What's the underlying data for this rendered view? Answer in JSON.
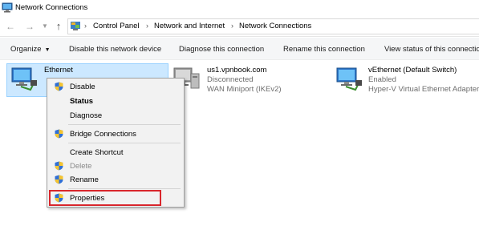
{
  "window": {
    "title": "Network Connections"
  },
  "address": {
    "crumbs": [
      "Control Panel",
      "Network and Internet",
      "Network Connections"
    ]
  },
  "toolbar": {
    "organize": "Organize",
    "disable": "Disable this network device",
    "diagnose": "Diagnose this connection",
    "rename": "Rename this connection",
    "view_status": "View status of this connection"
  },
  "items": [
    {
      "name": "Ethernet",
      "status": "",
      "adapter": "",
      "icon": "ethernet-adapter-icon",
      "selected": true
    },
    {
      "name": "us1.vpnbook.com",
      "status": "Disconnected",
      "adapter": "WAN Miniport (IKEv2)",
      "icon": "vpn-adapter-icon"
    },
    {
      "name": "vEthernet (Default Switch)",
      "status": "Enabled",
      "adapter": "Hyper-V Virtual Ethernet Adapter",
      "icon": "ethernet-adapter-icon"
    }
  ],
  "context_menu": {
    "items": [
      {
        "label": "Disable",
        "shield": true
      },
      {
        "label": "Status",
        "bold": true
      },
      {
        "label": "Diagnose"
      },
      {
        "label": "Bridge Connections",
        "shield": true
      },
      {
        "label": "Create Shortcut"
      },
      {
        "label": "Delete",
        "shield": true,
        "disabled": true
      },
      {
        "label": "Rename",
        "shield": true
      },
      {
        "label": "Properties",
        "shield": true,
        "highlighted": true
      }
    ]
  },
  "colors": {
    "selection": "#cce8ff",
    "highlight_border": "#d9262c",
    "command_bar": "#f5f6f7",
    "menu_bg": "#f2f2f2"
  }
}
